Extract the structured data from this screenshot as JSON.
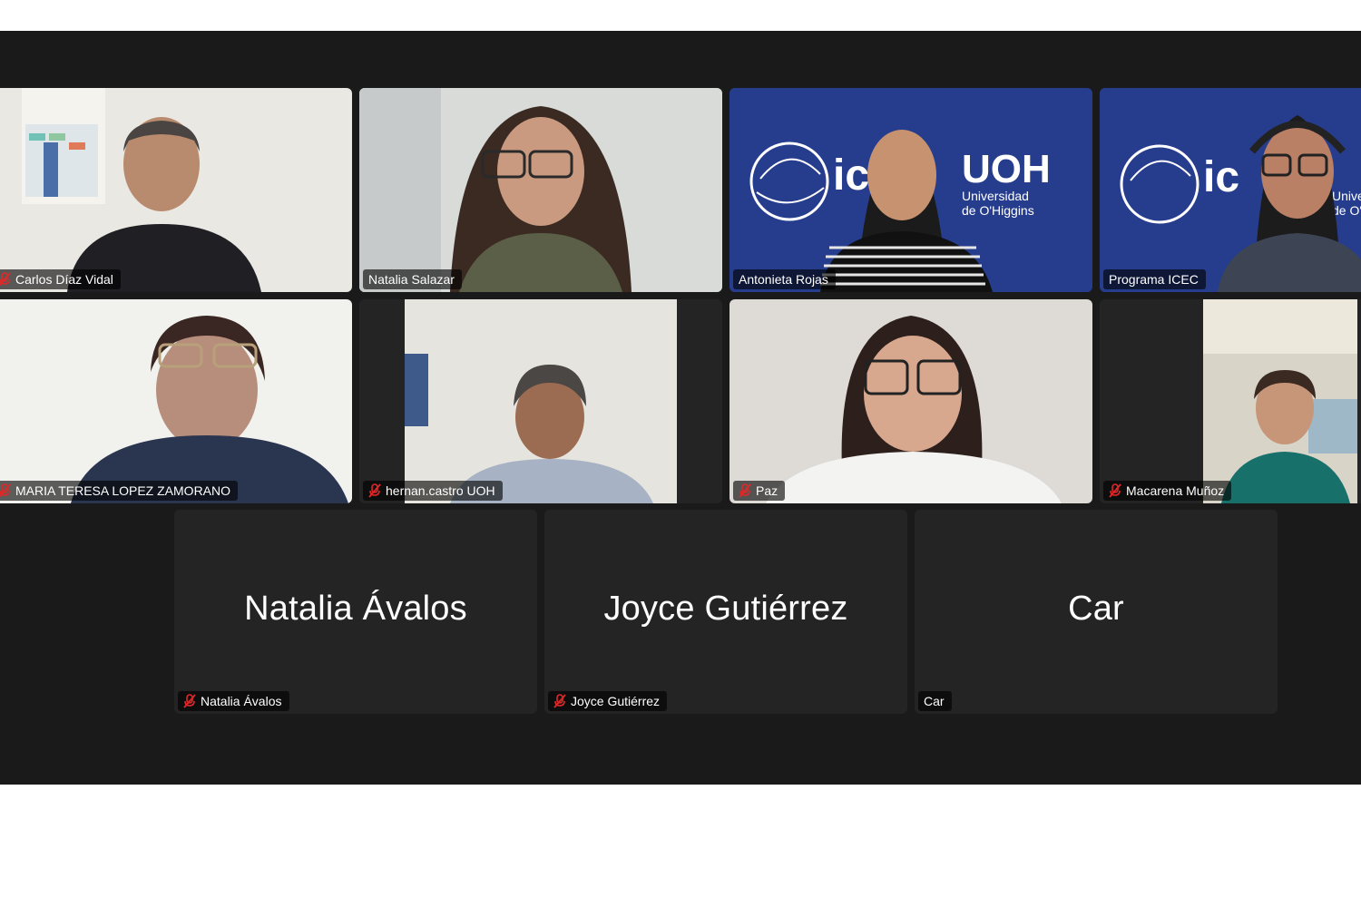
{
  "meeting": {
    "participants": [
      {
        "display": "Carlos Díaz Vidal",
        "muted": true,
        "video": true
      },
      {
        "display": "Natalia Salazar",
        "muted": false,
        "video": true,
        "speaking": true
      },
      {
        "display": "Antonieta Rojas",
        "muted": false,
        "video": true,
        "background_text": {
          "logo_left": "ic",
          "logo_right": "UOH",
          "university_line1": "Universidad",
          "university_line2": "de O'Higgins"
        }
      },
      {
        "display": "Programa ICEC",
        "muted": false,
        "video": true,
        "background_text": {
          "logo_left": "ic",
          "university_line1": "Unive",
          "university_line2": "de O'"
        }
      },
      {
        "display": "MARIA TERESA LOPEZ ZAMORANO",
        "muted": true,
        "video": true
      },
      {
        "display": "hernan.castro UOH",
        "muted": true,
        "video": true
      },
      {
        "display": "Paz",
        "muted": true,
        "video": true
      },
      {
        "display": "Macarena Muñoz",
        "muted": true,
        "video": true
      },
      {
        "display": "Natalia Ávalos",
        "muted": true,
        "video": false,
        "center_name": "Natalia Ávalos"
      },
      {
        "display": "Joyce Gutiérrez",
        "muted": true,
        "video": false,
        "center_name": "Joyce Gutiérrez"
      },
      {
        "display": "Car",
        "muted": false,
        "video": false,
        "center_name": "Car"
      }
    ]
  },
  "colors": {
    "meeting_bg": "#1a1a1a",
    "tile_bg": "#242424",
    "speaking_border": "#2bd15d",
    "mute_red": "#e02828",
    "brand_blue": "#243b8f"
  },
  "icons": {
    "mute": "microphone-muted-icon"
  }
}
